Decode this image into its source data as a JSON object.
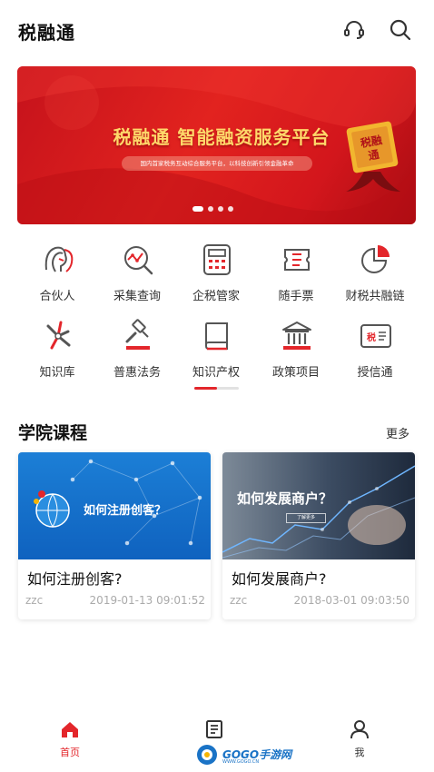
{
  "header": {
    "title": "税融通",
    "support_icon": "headset-icon",
    "search_icon": "search-icon"
  },
  "banner": {
    "headline": "税融通 智能融资服务平台",
    "subtitle": "国内首家税务互动综合服务平台，以科技创新引领金融革命",
    "seal_text": "税融通",
    "slide_count": 4,
    "active_slide": 1
  },
  "grid": {
    "items": [
      {
        "label": "合伙人",
        "icon": "partner-icon"
      },
      {
        "label": "采集查询",
        "icon": "data-query-icon"
      },
      {
        "label": "企税管家",
        "icon": "calculator-icon"
      },
      {
        "label": "随手票",
        "icon": "ticket-icon"
      },
      {
        "label": "财税共融链",
        "icon": "pie-chart-icon"
      },
      {
        "label": "知识库",
        "icon": "windmill-icon"
      },
      {
        "label": "普惠法务",
        "icon": "gavel-icon"
      },
      {
        "label": "知识产权",
        "icon": "book-icon"
      },
      {
        "label": "政策项目",
        "icon": "government-building-icon"
      },
      {
        "label": "授信通",
        "icon": "tax-card-icon"
      }
    ],
    "page_indicator": 0.5
  },
  "section": {
    "title": "学院课程",
    "more": "更多"
  },
  "courses": [
    {
      "thumb_text": "如何注册创客？",
      "title": "如何注册创客?",
      "author": "zzc",
      "date": "2019-01-13 09:01:52"
    },
    {
      "thumb_text": "如何发展商户？",
      "thumb_tag": "了解更多",
      "title": "如何发展商户?",
      "author": "zzc",
      "date": "2018-03-01 09:03:50"
    }
  ],
  "tabbar": {
    "tabs": [
      {
        "label": "首页",
        "icon": "home-icon",
        "active": true
      },
      {
        "label": "",
        "icon": "news-icon",
        "active": false
      },
      {
        "label": "我",
        "icon": "user-icon",
        "active": false
      }
    ]
  },
  "watermark": {
    "text": "GOGO手游网",
    "sub": "WWW.GOGO.CN"
  },
  "colors": {
    "accent": "#e3262b",
    "banner_red": "#d3161c",
    "headline_gold": "#ffd86a",
    "icon_dark": "#555555"
  }
}
